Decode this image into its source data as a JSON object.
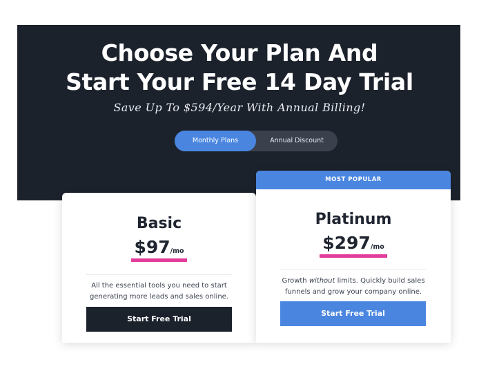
{
  "hero": {
    "title_line1": "Choose Your Plan And",
    "title_line2": "Start Your Free 14 Day Trial",
    "subtitle": "Save Up To $594/Year With Annual Billing!",
    "toggle": {
      "monthly_label": "Monthly Plans",
      "annual_label": "Annual Discount",
      "selected": "Monthly Plans"
    }
  },
  "plans": {
    "basic": {
      "name": "Basic",
      "price": "$97",
      "unit": "/mo",
      "description": "All the essential tools you need to start generating more leads and sales online.",
      "cta": "Start Free Trial"
    },
    "platinum": {
      "badge": "MOST POPULAR",
      "name": "Platinum",
      "price": "$297",
      "unit": "/mo",
      "description_before": "Growth ",
      "description_emphasis": "without",
      "description_after": " limits. Quickly build sales funnels and grow your company online.",
      "cta": "Start Free Trial"
    }
  },
  "colors": {
    "hero_bg": "#1c222c",
    "accent_blue": "#4a86e0",
    "underline_pink": "#e23b9c",
    "dark_button": "#1c222c"
  }
}
